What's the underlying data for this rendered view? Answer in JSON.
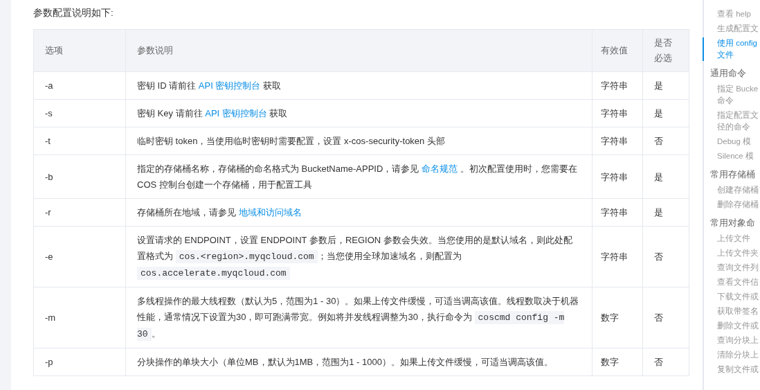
{
  "intro": "参数配置说明如下:",
  "table": {
    "columns": [
      "选项",
      "参数说明",
      "有效值",
      "是否必选"
    ],
    "rows": [
      {
        "option": "-a",
        "description": [
          {
            "kind": "text",
            "text": "密钥 ID 请前往 "
          },
          {
            "kind": "link",
            "text": "API 密钥控制台"
          },
          {
            "kind": "text",
            "text": " 获取"
          }
        ],
        "valid": "字符串",
        "required": "是"
      },
      {
        "option": "-s",
        "description": [
          {
            "kind": "text",
            "text": "密钥 Key 请前往 "
          },
          {
            "kind": "link",
            "text": "API 密钥控制台"
          },
          {
            "kind": "text",
            "text": " 获取"
          }
        ],
        "valid": "字符串",
        "required": "是"
      },
      {
        "option": "-t",
        "description": [
          {
            "kind": "text",
            "text": "临时密钥  token，当使用临时密钥时需要配置，设置 x-cos-security-token 头部"
          }
        ],
        "valid": "字符串",
        "required": "否"
      },
      {
        "option": "-b",
        "description": [
          {
            "kind": "text",
            "text": "指定的存储桶名称，存储桶的命名格式为 BucketName-APPID，请参见 "
          },
          {
            "kind": "link",
            "text": "命名规范"
          },
          {
            "kind": "text",
            "text": " 。初次配置使用时，您需要在 COS 控制台创建一个存储桶，用于配置工具"
          }
        ],
        "valid": "字符串",
        "required": "是"
      },
      {
        "option": "-r",
        "description": [
          {
            "kind": "text",
            "text": "存储桶所在地域，请参见 "
          },
          {
            "kind": "link",
            "text": "地域和访问域名"
          }
        ],
        "valid": "字符串",
        "required": "是"
      },
      {
        "option": "-e",
        "description": [
          {
            "kind": "text",
            "text": "设置请求的  ENDPOINT，设置 ENDPOINT 参数后，REGION 参数会失效。当您使用的是默认域名，则此处配置格式为 "
          },
          {
            "kind": "code",
            "text": "cos.<region>.myqcloud.com"
          },
          {
            "kind": "text",
            "text": "；当您使用全球加速域名，则配置为 "
          },
          {
            "kind": "code",
            "text": "cos.accelerate.myqcloud.com"
          }
        ],
        "valid": "字符串",
        "required": "否"
      },
      {
        "option": "-m",
        "description": [
          {
            "kind": "text",
            "text": "多线程操作的最大线程数（默认为5，范围为1 - 30）。如果上传文件缓慢，可适当调高该值。线程数取决于机器性能，通常情况下设置为30，即可跑满带宽。例如将并发线程调整为30，执行命令为 "
          },
          {
            "kind": "code",
            "text": "coscmd config -m 30"
          },
          {
            "kind": "text",
            "text": "。"
          }
        ],
        "valid": "数字",
        "required": "否"
      },
      {
        "option": "-p",
        "description": [
          {
            "kind": "text",
            "text": "分块操作的单块大小（单位MB，默认为1MB，范围为1 - 1000）。如果上传文件缓慢，可适当调高该值。"
          }
        ],
        "valid": "数字",
        "required": "否"
      }
    ]
  },
  "toc": [
    {
      "kind": "item",
      "lines": [
        "查看 help"
      ],
      "selected": false
    },
    {
      "kind": "item",
      "lines": [
        "生成配置文"
      ],
      "selected": false
    },
    {
      "kind": "item",
      "lines": [
        "使用 config",
        "文件"
      ],
      "selected": true
    },
    {
      "kind": "heading",
      "lines": [
        "通用命令"
      ]
    },
    {
      "kind": "item",
      "lines": [
        "指定 Bucke",
        "命令"
      ],
      "selected": false
    },
    {
      "kind": "item",
      "lines": [
        "指定配置文",
        "径的命令"
      ],
      "selected": false
    },
    {
      "kind": "item",
      "lines": [
        "Debug 模"
      ],
      "selected": false
    },
    {
      "kind": "item",
      "lines": [
        "Silence 模"
      ],
      "selected": false
    },
    {
      "kind": "heading",
      "lines": [
        "常用存储桶"
      ]
    },
    {
      "kind": "item",
      "lines": [
        "创建存储桶"
      ],
      "selected": false
    },
    {
      "kind": "item",
      "lines": [
        "删除存储桶"
      ],
      "selected": false
    },
    {
      "kind": "heading",
      "lines": [
        "常用对象命"
      ]
    },
    {
      "kind": "item",
      "lines": [
        "上传文件"
      ],
      "selected": false
    },
    {
      "kind": "item",
      "lines": [
        "上传文件夹"
      ],
      "selected": false
    },
    {
      "kind": "item",
      "lines": [
        "查询文件列"
      ],
      "selected": false
    },
    {
      "kind": "item",
      "lines": [
        "查看文件信"
      ],
      "selected": false
    },
    {
      "kind": "item",
      "lines": [
        "下载文件或"
      ],
      "selected": false
    },
    {
      "kind": "item",
      "lines": [
        "获取带签名"
      ],
      "selected": false
    },
    {
      "kind": "item",
      "lines": [
        "删除文件或"
      ],
      "selected": false
    },
    {
      "kind": "item",
      "lines": [
        "查询分块上"
      ],
      "selected": false
    },
    {
      "kind": "item",
      "lines": [
        "清除分块上"
      ],
      "selected": false
    },
    {
      "kind": "item",
      "lines": [
        "复制文件或"
      ],
      "selected": false
    }
  ]
}
